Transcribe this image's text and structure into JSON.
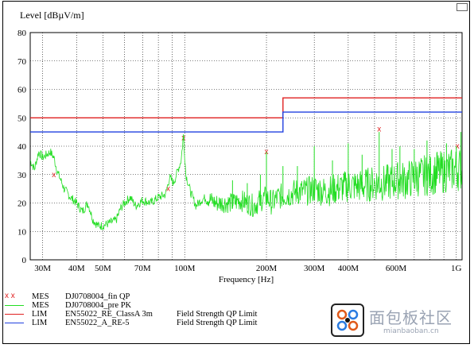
{
  "chart_data": {
    "type": "line",
    "title": "Level [dBµV/m]",
    "xlabel": "Frequency [Hz]",
    "ylabel": "Level [dBµV/m]",
    "xscale": "log",
    "xlim": [
      27000000,
      1050000000
    ],
    "ylim": [
      0,
      80
    ],
    "grid": true,
    "y_ticks": [
      0,
      10,
      20,
      30,
      40,
      50,
      60,
      70,
      80
    ],
    "x_ticks": [
      {
        "value": 30000000,
        "label": "30M"
      },
      {
        "value": 40000000,
        "label": "40M"
      },
      {
        "value": 50000000,
        "label": "50M"
      },
      {
        "value": 70000000,
        "label": "70M"
      },
      {
        "value": 100000000,
        "label": "100M"
      },
      {
        "value": 200000000,
        "label": "200M"
      },
      {
        "value": 300000000,
        "label": "300M"
      },
      {
        "value": 400000000,
        "label": "400M"
      },
      {
        "value": 600000000,
        "label": "600M"
      },
      {
        "value": 1000000000,
        "label": "1G"
      }
    ],
    "x_minor_grid": [
      60000000,
      80000000,
      90000000,
      500000000,
      700000000,
      800000000,
      900000000
    ],
    "series": [
      {
        "name": "DJ0708004_fin QP",
        "kind": "MES",
        "color": "#e02020",
        "style": "marker-x",
        "points": [
          {
            "x": 33000000,
            "y": 30
          },
          {
            "x": 87000000,
            "y": 25
          },
          {
            "x": 99000000,
            "y": 43
          },
          {
            "x": 200000000,
            "y": 38
          },
          {
            "x": 520000000,
            "y": 46
          },
          {
            "x": 1010000000,
            "y": 40
          }
        ]
      },
      {
        "name": "DJ0708004_pre PK",
        "kind": "MES",
        "color": "#22dd22",
        "style": "noisy-line",
        "points": [
          {
            "x": 27000000,
            "y": 35
          },
          {
            "x": 28000000,
            "y": 32
          },
          {
            "x": 29000000,
            "y": 38
          },
          {
            "x": 30000000,
            "y": 36
          },
          {
            "x": 31000000,
            "y": 37
          },
          {
            "x": 32000000,
            "y": 38
          },
          {
            "x": 33000000,
            "y": 36
          },
          {
            "x": 34000000,
            "y": 31
          },
          {
            "x": 35000000,
            "y": 28
          },
          {
            "x": 36000000,
            "y": 25
          },
          {
            "x": 38000000,
            "y": 22
          },
          {
            "x": 40000000,
            "y": 20
          },
          {
            "x": 42000000,
            "y": 17
          },
          {
            "x": 44000000,
            "y": 20
          },
          {
            "x": 46000000,
            "y": 14
          },
          {
            "x": 48000000,
            "y": 12
          },
          {
            "x": 50000000,
            "y": 12
          },
          {
            "x": 53000000,
            "y": 13
          },
          {
            "x": 56000000,
            "y": 14
          },
          {
            "x": 58000000,
            "y": 18
          },
          {
            "x": 60000000,
            "y": 20
          },
          {
            "x": 63000000,
            "y": 22
          },
          {
            "x": 66000000,
            "y": 19
          },
          {
            "x": 70000000,
            "y": 21
          },
          {
            "x": 75000000,
            "y": 20
          },
          {
            "x": 80000000,
            "y": 22
          },
          {
            "x": 85000000,
            "y": 23
          },
          {
            "x": 88000000,
            "y": 29
          },
          {
            "x": 91000000,
            "y": 27
          },
          {
            "x": 94000000,
            "y": 31
          },
          {
            "x": 97000000,
            "y": 35
          },
          {
            "x": 99000000,
            "y": 44
          },
          {
            "x": 101000000,
            "y": 30
          },
          {
            "x": 105000000,
            "y": 24
          },
          {
            "x": 110000000,
            "y": 19
          },
          {
            "x": 115000000,
            "y": 21
          },
          {
            "x": 120000000,
            "y": 22
          },
          {
            "x": 130000000,
            "y": 20
          },
          {
            "x": 140000000,
            "y": 20
          },
          {
            "x": 150000000,
            "y": 20
          },
          {
            "x": 160000000,
            "y": 21
          },
          {
            "x": 170000000,
            "y": 20
          },
          {
            "x": 180000000,
            "y": 19
          },
          {
            "x": 190000000,
            "y": 21
          },
          {
            "x": 200000000,
            "y": 22
          },
          {
            "x": 210000000,
            "y": 20
          },
          {
            "x": 220000000,
            "y": 22
          },
          {
            "x": 240000000,
            "y": 23
          },
          {
            "x": 260000000,
            "y": 24
          },
          {
            "x": 280000000,
            "y": 24
          },
          {
            "x": 300000000,
            "y": 25
          },
          {
            "x": 330000000,
            "y": 24
          },
          {
            "x": 360000000,
            "y": 25
          },
          {
            "x": 400000000,
            "y": 26
          },
          {
            "x": 450000000,
            "y": 26
          },
          {
            "x": 500000000,
            "y": 27
          },
          {
            "x": 550000000,
            "y": 27
          },
          {
            "x": 600000000,
            "y": 28
          },
          {
            "x": 650000000,
            "y": 28
          },
          {
            "x": 700000000,
            "y": 29
          },
          {
            "x": 800000000,
            "y": 30
          },
          {
            "x": 900000000,
            "y": 31
          },
          {
            "x": 1000000000,
            "y": 32
          },
          {
            "x": 1050000000,
            "y": 32
          }
        ],
        "spikes": [
          {
            "x": 99000000,
            "y": 44
          },
          {
            "x": 150000000,
            "y": 28
          },
          {
            "x": 170000000,
            "y": 27
          },
          {
            "x": 190000000,
            "y": 30
          },
          {
            "x": 200000000,
            "y": 38
          },
          {
            "x": 230000000,
            "y": 33
          },
          {
            "x": 260000000,
            "y": 33
          },
          {
            "x": 300000000,
            "y": 40
          },
          {
            "x": 350000000,
            "y": 35
          },
          {
            "x": 400000000,
            "y": 41
          },
          {
            "x": 450000000,
            "y": 37
          },
          {
            "x": 520000000,
            "y": 45
          },
          {
            "x": 580000000,
            "y": 39
          },
          {
            "x": 620000000,
            "y": 40
          },
          {
            "x": 700000000,
            "y": 39
          },
          {
            "x": 780000000,
            "y": 42
          },
          {
            "x": 850000000,
            "y": 38
          },
          {
            "x": 920000000,
            "y": 41
          },
          {
            "x": 1000000000,
            "y": 40
          },
          {
            "x": 1040000000,
            "y": 45
          }
        ]
      },
      {
        "name": "EN55022_RE_ClassA 3m",
        "kind": "LIM",
        "desc": "Field Strength QP Limit",
        "color": "#e02020",
        "style": "step-line",
        "points": [
          {
            "x": 27000000,
            "y": 50
          },
          {
            "x": 230000000,
            "y": 50
          },
          {
            "x": 230000000,
            "y": 57
          },
          {
            "x": 1050000000,
            "y": 57
          }
        ]
      },
      {
        "name": "EN55022_A_RE-5",
        "kind": "LIM",
        "desc": "Field Strength QP Limit",
        "color": "#2040e0",
        "style": "step-line",
        "points": [
          {
            "x": 27000000,
            "y": 45
          },
          {
            "x": 230000000,
            "y": 45
          },
          {
            "x": 230000000,
            "y": 52
          },
          {
            "x": 1050000000,
            "y": 52
          }
        ]
      }
    ]
  },
  "legend": [
    {
      "symbol": "x x",
      "kind": "MES",
      "name": "DJ0708004_fin QP",
      "desc": "",
      "color": "#e02020"
    },
    {
      "symbol": "",
      "kind": "MES",
      "name": "DJ0708004_pre PK",
      "desc": "",
      "color": "#22dd22"
    },
    {
      "symbol": "",
      "kind": "LIM",
      "name": "EN55022_RE_ClassA 3m",
      "desc": "Field Strength QP Limit",
      "color": "#e02020"
    },
    {
      "symbol": "",
      "kind": "LIM",
      "name": "EN55022_A_RE-5",
      "desc": "Field Strength QP Limit",
      "color": "#2040e0"
    }
  ],
  "watermark": {
    "title": "面包板社区",
    "url": "mianbaoban.cn"
  }
}
